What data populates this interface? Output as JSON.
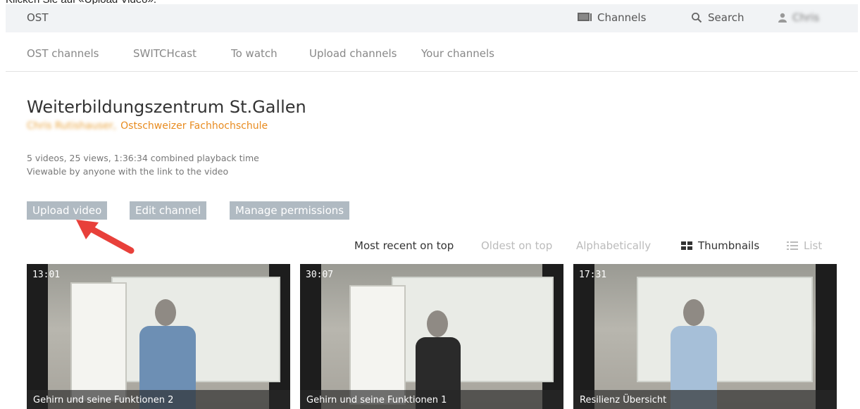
{
  "caption": "Klicken Sie auf «Upload Video».",
  "header": {
    "brand": "OST",
    "channels_label": "Channels",
    "search_label": "Search",
    "user_label": "Chris"
  },
  "subnav": {
    "items": [
      {
        "label": "OST channels"
      },
      {
        "label": "SWITCHcast"
      },
      {
        "label": "To watch"
      },
      {
        "label": "Upload channels"
      },
      {
        "label": "Your channels"
      }
    ]
  },
  "channel": {
    "title": "Weiterbildungszentrum St.Gallen",
    "owner_name": "Chris Rutishauser,",
    "organization": "Ostschweizer Fachhochschule",
    "stats_line": "5 videos, 25 views, 1:36:34 combined playback time",
    "visibility": "Viewable by anyone with the link to the video"
  },
  "actions": {
    "upload": "Upload video",
    "edit": "Edit channel",
    "permissions": "Manage permissions"
  },
  "sorting": {
    "recent": "Most recent on top",
    "oldest": "Oldest on top",
    "alpha": "Alphabetically",
    "active": "Most recent on top"
  },
  "view_modes": {
    "thumbnails": "Thumbnails",
    "list": "List",
    "active": "Thumbnails"
  },
  "videos": [
    {
      "duration": "13:01",
      "title": "Gehirn und seine Funktionen 2"
    },
    {
      "duration": "30:07",
      "title": "Gehirn und seine Funktionen 1"
    },
    {
      "duration": "17:31",
      "title": "Resilienz Übersicht"
    }
  ],
  "colors": {
    "accent": "#e88b1f",
    "button": "#b0bac2",
    "arrow": "#e8403a"
  }
}
